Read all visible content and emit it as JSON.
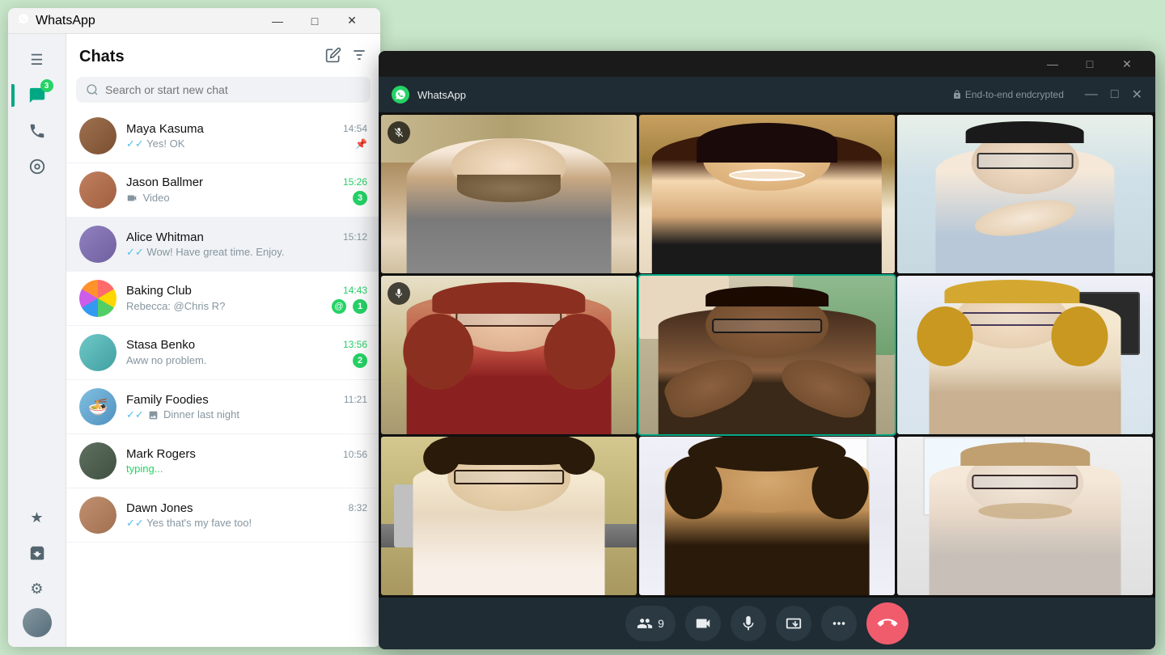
{
  "app": {
    "name": "WhatsApp",
    "logo": "W"
  },
  "main_window": {
    "title": "WhatsApp",
    "win_controls": [
      "—",
      "□",
      "✕"
    ]
  },
  "sidebar": {
    "badge_count": "3",
    "icons": [
      {
        "name": "menu-icon",
        "symbol": "☰"
      },
      {
        "name": "chats-icon",
        "symbol": "💬"
      },
      {
        "name": "calls-icon",
        "symbol": "📞"
      },
      {
        "name": "status-icon",
        "symbol": "◎"
      },
      {
        "name": "starred-icon",
        "symbol": "★"
      },
      {
        "name": "archived-icon",
        "symbol": "🗄"
      },
      {
        "name": "settings-icon",
        "symbol": "⚙"
      }
    ]
  },
  "chats_panel": {
    "title": "Chats",
    "compose_icon": "✏",
    "filter_icon": "≡",
    "search": {
      "placeholder": "Search or start new chat",
      "icon": "🔍"
    },
    "chat_list": [
      {
        "id": "maya",
        "name": "Maya Kasuma",
        "preview": "Yes! OK",
        "time": "14:54",
        "unread": false,
        "pinned": true,
        "tick": "double",
        "av_class": "av-1"
      },
      {
        "id": "jason",
        "name": "Jason Ballmer",
        "preview": "🎬 Video",
        "time": "15:26",
        "unread": true,
        "unread_count": "3",
        "av_class": "av-2"
      },
      {
        "id": "alice",
        "name": "Alice Whitman",
        "preview": "✓✓ Wow! Have great time. Enjoy.",
        "time": "15:12",
        "unread": false,
        "active": true,
        "av_class": "av-3"
      },
      {
        "id": "baking",
        "name": "Baking Club",
        "preview": "Rebecca: @Chris R?",
        "time": "14:43",
        "unread": true,
        "unread_count": "1",
        "mention": true,
        "av_class": "av-4"
      },
      {
        "id": "stasa",
        "name": "Stasa Benko",
        "preview": "Aww no problem.",
        "time": "13:56",
        "unread": true,
        "unread_count": "2",
        "av_class": "av-5"
      },
      {
        "id": "family",
        "name": "Family Foodies",
        "preview": "✓✓ 🖼 Dinner last night",
        "time": "11:21",
        "unread": false,
        "av_class": "av-6"
      },
      {
        "id": "mark",
        "name": "Mark Rogers",
        "preview": "typing...",
        "time": "10:56",
        "typing": true,
        "av_class": "av-7"
      },
      {
        "id": "dawn",
        "name": "Dawn Jones",
        "preview": "✓✓ Yes that's my fave too!",
        "time": "8:32",
        "unread": false,
        "av_class": "av-1"
      }
    ]
  },
  "video_call": {
    "app_name": "WhatsApp",
    "encrypted_label": "End-to-end endcrypted",
    "participants_count": "9",
    "controls": [
      {
        "name": "participants-button",
        "label": "9",
        "icon": "👥"
      },
      {
        "name": "camera-button",
        "icon": "📹"
      },
      {
        "name": "mute-button",
        "icon": "🎤"
      },
      {
        "name": "screen-share-button",
        "icon": "📤"
      },
      {
        "name": "more-button",
        "icon": "•••"
      },
      {
        "name": "end-call-button",
        "icon": "📞"
      }
    ],
    "cells": [
      {
        "id": 1,
        "muted": true,
        "highlighted": false,
        "bg": "bg-kitchen"
      },
      {
        "id": 2,
        "muted": false,
        "highlighted": false,
        "bg": "bg-bright"
      },
      {
        "id": 3,
        "muted": false,
        "highlighted": false,
        "bg": "bg-office"
      },
      {
        "id": 4,
        "muted": true,
        "highlighted": false,
        "bg": "bg-warm"
      },
      {
        "id": 5,
        "muted": false,
        "highlighted": true,
        "bg": "bg-office"
      },
      {
        "id": 6,
        "muted": false,
        "highlighted": false,
        "bg": "bg-bright"
      },
      {
        "id": 7,
        "muted": false,
        "highlighted": false,
        "bg": "bg-warm"
      },
      {
        "id": 8,
        "muted": false,
        "highlighted": false,
        "bg": "bg-bright"
      },
      {
        "id": 9,
        "muted": false,
        "highlighted": false,
        "bg": "bg-office"
      }
    ]
  }
}
